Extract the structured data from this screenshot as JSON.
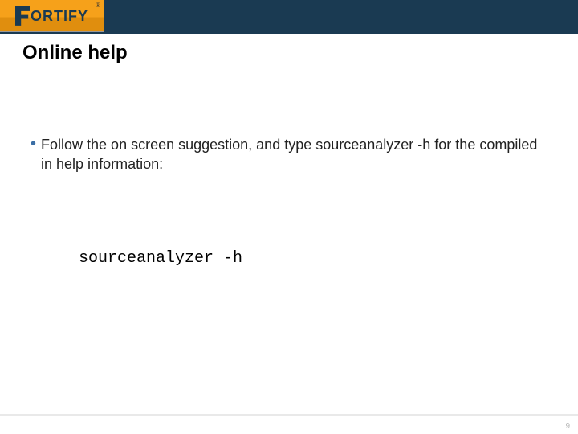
{
  "header": {
    "logo": {
      "brand_rest": "ORTIFY",
      "registered": "®"
    }
  },
  "title": "Online help",
  "content": {
    "bullets": [
      "Follow the on screen suggestion, and type sourceanalyzer -h for the compiled in help information:"
    ],
    "code": "sourceanalyzer -h"
  },
  "footer": {
    "page": "9"
  }
}
